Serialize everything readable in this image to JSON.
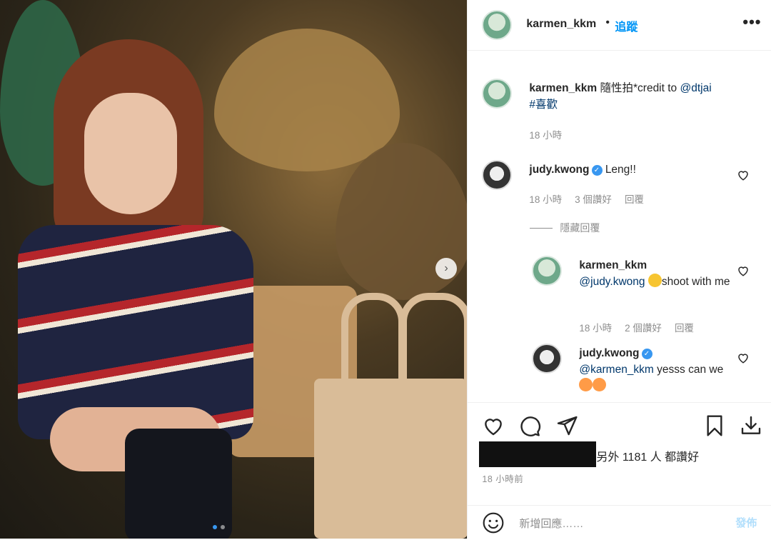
{
  "header": {
    "username": "karmen_kkm",
    "separator": "•",
    "follow_label": "追蹤",
    "more_label": "•••"
  },
  "caption": {
    "username": "karmen_kkm",
    "text": "隨性拍*credit to ",
    "mention": "@dtjai",
    "hashtag": "#喜歡",
    "time": "18 小時"
  },
  "comments": [
    {
      "username": "judy.kwong",
      "text": "Leng!!",
      "time": "18 小時",
      "likes": "3 個讚好",
      "reply": "回覆"
    },
    {
      "username": "karmen_kkm",
      "mention": "@judy.kwong",
      "text_after": "shoot with me",
      "time": "18 小時",
      "likes": "2 個讚好",
      "reply": "回覆"
    },
    {
      "username": "judy.kwong",
      "mention": "@karmen_kkm",
      "text_after": "yesss can we"
    }
  ],
  "hide_replies_label": "隱藏回覆",
  "likes_text": "另外 1181 人 都讚好",
  "post_time": "18 小時前",
  "comment_box": {
    "placeholder": "新增回應……",
    "post_label": "發佈"
  },
  "icons": {
    "like": "heart-icon",
    "comment": "comment-icon",
    "share": "paper-plane-icon",
    "save": "bookmark-icon",
    "download": "download-icon",
    "emoji": "smiley-icon",
    "next": "chevron-right-icon",
    "verified": "verified-badge-icon"
  },
  "carousel": {
    "total": 2,
    "current": 1
  },
  "colors": {
    "link": "#0095f6",
    "mention": "#00376b",
    "meta": "#8e8e8e",
    "verified": "#3897f0",
    "post_disabled": "#b2dffc"
  }
}
